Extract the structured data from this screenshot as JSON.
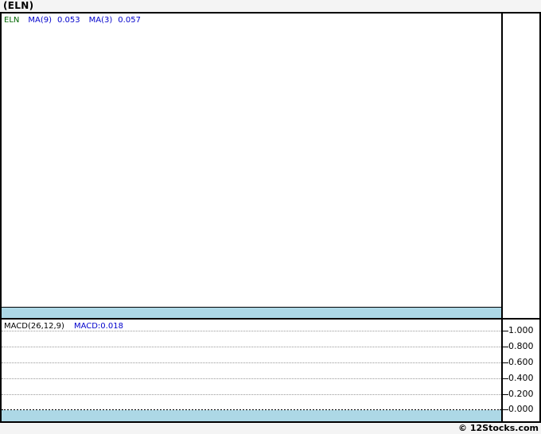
{
  "page": {
    "title": "(ELN)",
    "footer": "© 12Stocks.com"
  },
  "main_chart": {
    "legend": {
      "symbol": "ELN",
      "ma9_label": "MA(9)",
      "ma9_value": "0.053",
      "ma3_label": "MA(3)",
      "ma3_value": "0.057"
    }
  },
  "macd_panel": {
    "indicator_label": "MACD(26,12,9)",
    "indicator_value": "MACD:0.018",
    "axis_ticks": [
      "1.000",
      "0.800",
      "0.600",
      "0.400",
      "0.200",
      "0.000"
    ]
  },
  "colors": {
    "band_blue": "#ADD8E6",
    "legend_green": "#006600",
    "legend_blue": "#0000CC",
    "grid_gray": "#999999",
    "border_black": "#000000",
    "page_background": "#F4F4F4",
    "plot_background": "#FFFFFF"
  },
  "chart_data": [
    {
      "type": "line",
      "title": "ELN price panel with moving averages",
      "series": [
        {
          "name": "ELN",
          "values": []
        },
        {
          "name": "MA(9)",
          "values": [],
          "last_value": 0.053
        },
        {
          "name": "MA(3)",
          "values": [],
          "last_value": 0.057
        }
      ],
      "legend_position": "top-left",
      "grid": false,
      "note": "plot area is empty; no price line is drawn"
    },
    {
      "type": "line",
      "title": "MACD(26,12,9)",
      "series": [
        {
          "name": "MACD",
          "values": [],
          "last_value": 0.018
        }
      ],
      "ylabel": "",
      "tick_labels": [
        1.0,
        0.8,
        0.6,
        0.4,
        0.2,
        0.0
      ],
      "ylim": [
        -0.05,
        1.08
      ],
      "grid": true,
      "grid_style": "dotted horizontal",
      "zero_line": "dotted black",
      "legend_position": "top-left",
      "note": "no MACD line visible in plot area"
    }
  ],
  "layout_constants": {
    "gridline_tops": [
      399,
      419,
      439,
      459,
      479,
      498
    ]
  }
}
